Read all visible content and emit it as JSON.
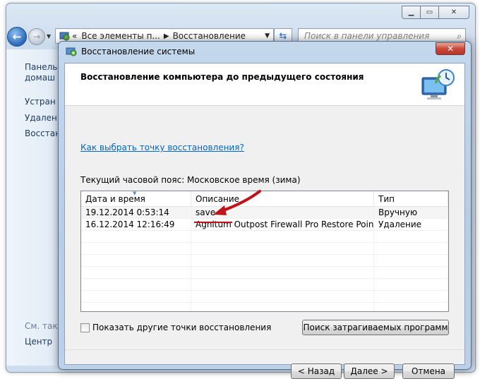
{
  "control_panel": {
    "address_parts": [
      "Все элементы п...",
      "Восстановление"
    ],
    "address_sep_glyph": "«",
    "search_placeholder": "Поиск в панели управления",
    "sidebar_links": [
      "Панель",
      "домаш",
      "Устран",
      "Удален",
      "Восстан"
    ],
    "see_also": "См. так",
    "sidebar_bottom": "Центр"
  },
  "dialog": {
    "title": "Восстановление системы",
    "close_glyph": "✕",
    "header_title": "Восстановление компьютера до предыдущего состояния",
    "how_to_link": "Как выбрать точку восстановления?",
    "timezone_label": "Текущий часовой пояс: Московское время (зима)",
    "columns": [
      "Дата и время",
      "Описание",
      "Тип"
    ],
    "rows": [
      {
        "date": "19.12.2014 0:53:14",
        "description": "save",
        "type": "Вручную"
      },
      {
        "date": "16.12.2014 12:16:49",
        "description": "Agnitum Outpost Firewall Pro Restore Point: unin...",
        "type": "Удаление"
      }
    ],
    "show_more_label": "Показать другие точки восстановления",
    "scan_button": "Поиск затрагиваемых программ",
    "back_button": "< Назад",
    "next_button": "Далее >",
    "cancel_button": "Отмена"
  },
  "colors": {
    "link": "#0066cc",
    "annotation_arrow": "#c0141b",
    "close_button": "#c9483a"
  }
}
